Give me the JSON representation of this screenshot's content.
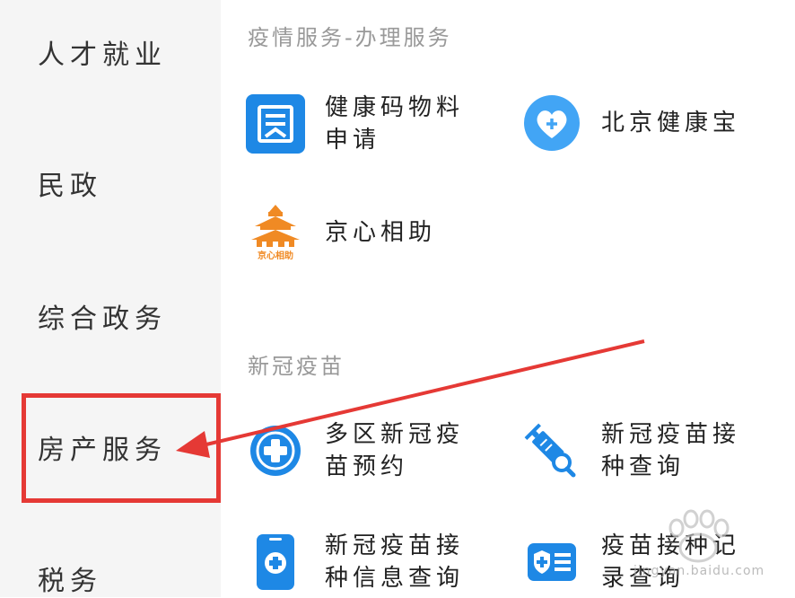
{
  "sidebar": {
    "items": [
      {
        "label": "人才就业"
      },
      {
        "label": "民政"
      },
      {
        "label": "综合政务"
      },
      {
        "label": "房产服务"
      },
      {
        "label": "税务"
      }
    ]
  },
  "sections": [
    {
      "title": "疫情服务-办理服务",
      "services": [
        {
          "label": "健康码物料申请",
          "icon": "document-card-icon"
        },
        {
          "label": "北京健康宝",
          "icon": "heart-plus-icon"
        },
        {
          "label": "京心相助",
          "icon": "temple-logo-icon",
          "logo_text": "京心相助"
        }
      ]
    },
    {
      "title": "新冠疫苗",
      "services": [
        {
          "label": "多区新冠疫苗预约",
          "icon": "medical-cross-icon"
        },
        {
          "label": "新冠疫苗接种查询",
          "icon": "syringe-search-icon"
        },
        {
          "label": "新冠疫苗接种信息查询",
          "icon": "phone-cross-icon"
        },
        {
          "label": "疫苗接种记录查询",
          "icon": "medical-id-card-icon"
        }
      ]
    }
  ],
  "watermark": {
    "text": "jingyan.baidu.com"
  },
  "colors": {
    "primary_blue": "#1e88e5",
    "annotation_red": "#e53935",
    "logo_orange": "#f08a24"
  }
}
